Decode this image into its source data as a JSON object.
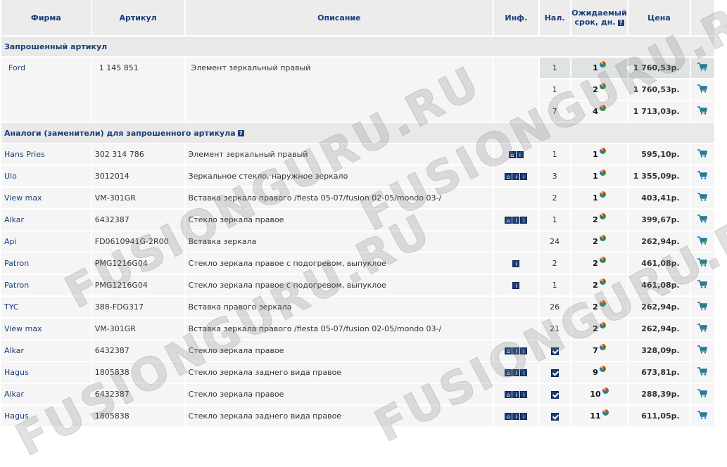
{
  "header": {
    "firm": "Фирма",
    "article": "Артикул",
    "description": "Описание",
    "info": "Инф.",
    "availability": "Нал.",
    "expected_line1": "Ожидаемый",
    "expected_line2": "срок, дн.",
    "price": "Цена",
    "help": "?"
  },
  "requested_section": {
    "title": "Запрошенный артикул",
    "firm": "Ford",
    "article": "1 145 851",
    "description": "Элемент зеркальный правый",
    "offers": [
      {
        "qty": "1",
        "days": "1",
        "price": "1 760,53р."
      },
      {
        "qty": "1",
        "days": "2",
        "price": "1 760,53р."
      },
      {
        "qty": "7",
        "days": "4",
        "price": "1 713,03р."
      }
    ]
  },
  "analogs_section": {
    "title": "Аналоги (заменители) для запрошенного артикула",
    "help": "?",
    "rows": [
      {
        "firm": "Hans Pries",
        "article": "302 314 786",
        "description": "Элемент зеркальный правый",
        "info": "hi",
        "qty": "1",
        "days": "1",
        "price": "595,10р."
      },
      {
        "firm": "Ulo",
        "article": "3012014",
        "description": "Зеркальное стекло, наружное зеркало",
        "info": "hii",
        "qty": "3",
        "days": "1",
        "price": "1 355,09р."
      },
      {
        "firm": "View max",
        "article": "VM-301GR",
        "description": "Вставка зеркала правого /fiesta 05-07/fusion 02-05/mondo 03-/",
        "info": "",
        "qty": "2",
        "days": "1",
        "price": "403,41р."
      },
      {
        "firm": "Alkar",
        "article": "6432387",
        "description": "Стекло зеркала правое",
        "info": "hii",
        "qty": "1",
        "days": "2",
        "price": "399,67р."
      },
      {
        "firm": "Api",
        "article": "FD0610941G-2R00",
        "description": "Вставка зеркала",
        "info": "",
        "qty": "24",
        "days": "2",
        "price": "262,94р."
      },
      {
        "firm": "Patron",
        "article": "PMG1216G04",
        "description": "Стекло зеркала правое с подогревом, выпуклое",
        "info": "i",
        "qty": "2",
        "days": "2",
        "price": "461,08р."
      },
      {
        "firm": "Patron",
        "article": "PMG1216G04",
        "description": "Стекло зеркала правое с подогревом, выпуклое",
        "info": "i",
        "qty": "1",
        "days": "2",
        "price": "461,08р."
      },
      {
        "firm": "TYC",
        "article": "388-FDG317",
        "description": "Вставка правого зеркала",
        "info": "",
        "qty": "26",
        "days": "2",
        "price": "262,94р."
      },
      {
        "firm": "View max",
        "article": "VM-301GR",
        "description": "Вставка зеркала правого /fiesta 05-07/fusion 02-05/mondo 03-/",
        "info": "",
        "qty": "21",
        "days": "2",
        "price": "262,94р."
      },
      {
        "firm": "Alkar",
        "article": "6432387",
        "description": "Стекло зеркала правое",
        "info": "hii",
        "qty": "check",
        "days": "7",
        "price": "328,09р."
      },
      {
        "firm": "Hagus",
        "article": "1805838",
        "description": "Стекло зеркала заднего вида правое",
        "info": "hii",
        "qty": "check",
        "days": "9",
        "price": "673,81р."
      },
      {
        "firm": "Alkar",
        "article": "6432387",
        "description": "Стекло зеркала правое",
        "info": "hii",
        "qty": "check",
        "days": "10",
        "price": "288,39р."
      },
      {
        "firm": "Hagus",
        "article": "1805838",
        "description": "Стекло зеркала заднего вида правое",
        "info": "hii",
        "qty": "check",
        "days": "11",
        "price": "611,05р."
      }
    ]
  },
  "icons": {
    "cart": "cart-icon",
    "pie": "delivery-stats-icon",
    "home": "home-icon",
    "info": "info-icon",
    "check": "checkbox-icon"
  },
  "colors": {
    "header_text": "#1a3d7a",
    "row_bg": "#f5f5f5",
    "highlight_bg": "#dfe3e3",
    "cart": "#1a6fb0"
  },
  "watermark": "FUSIONGURU.RU"
}
